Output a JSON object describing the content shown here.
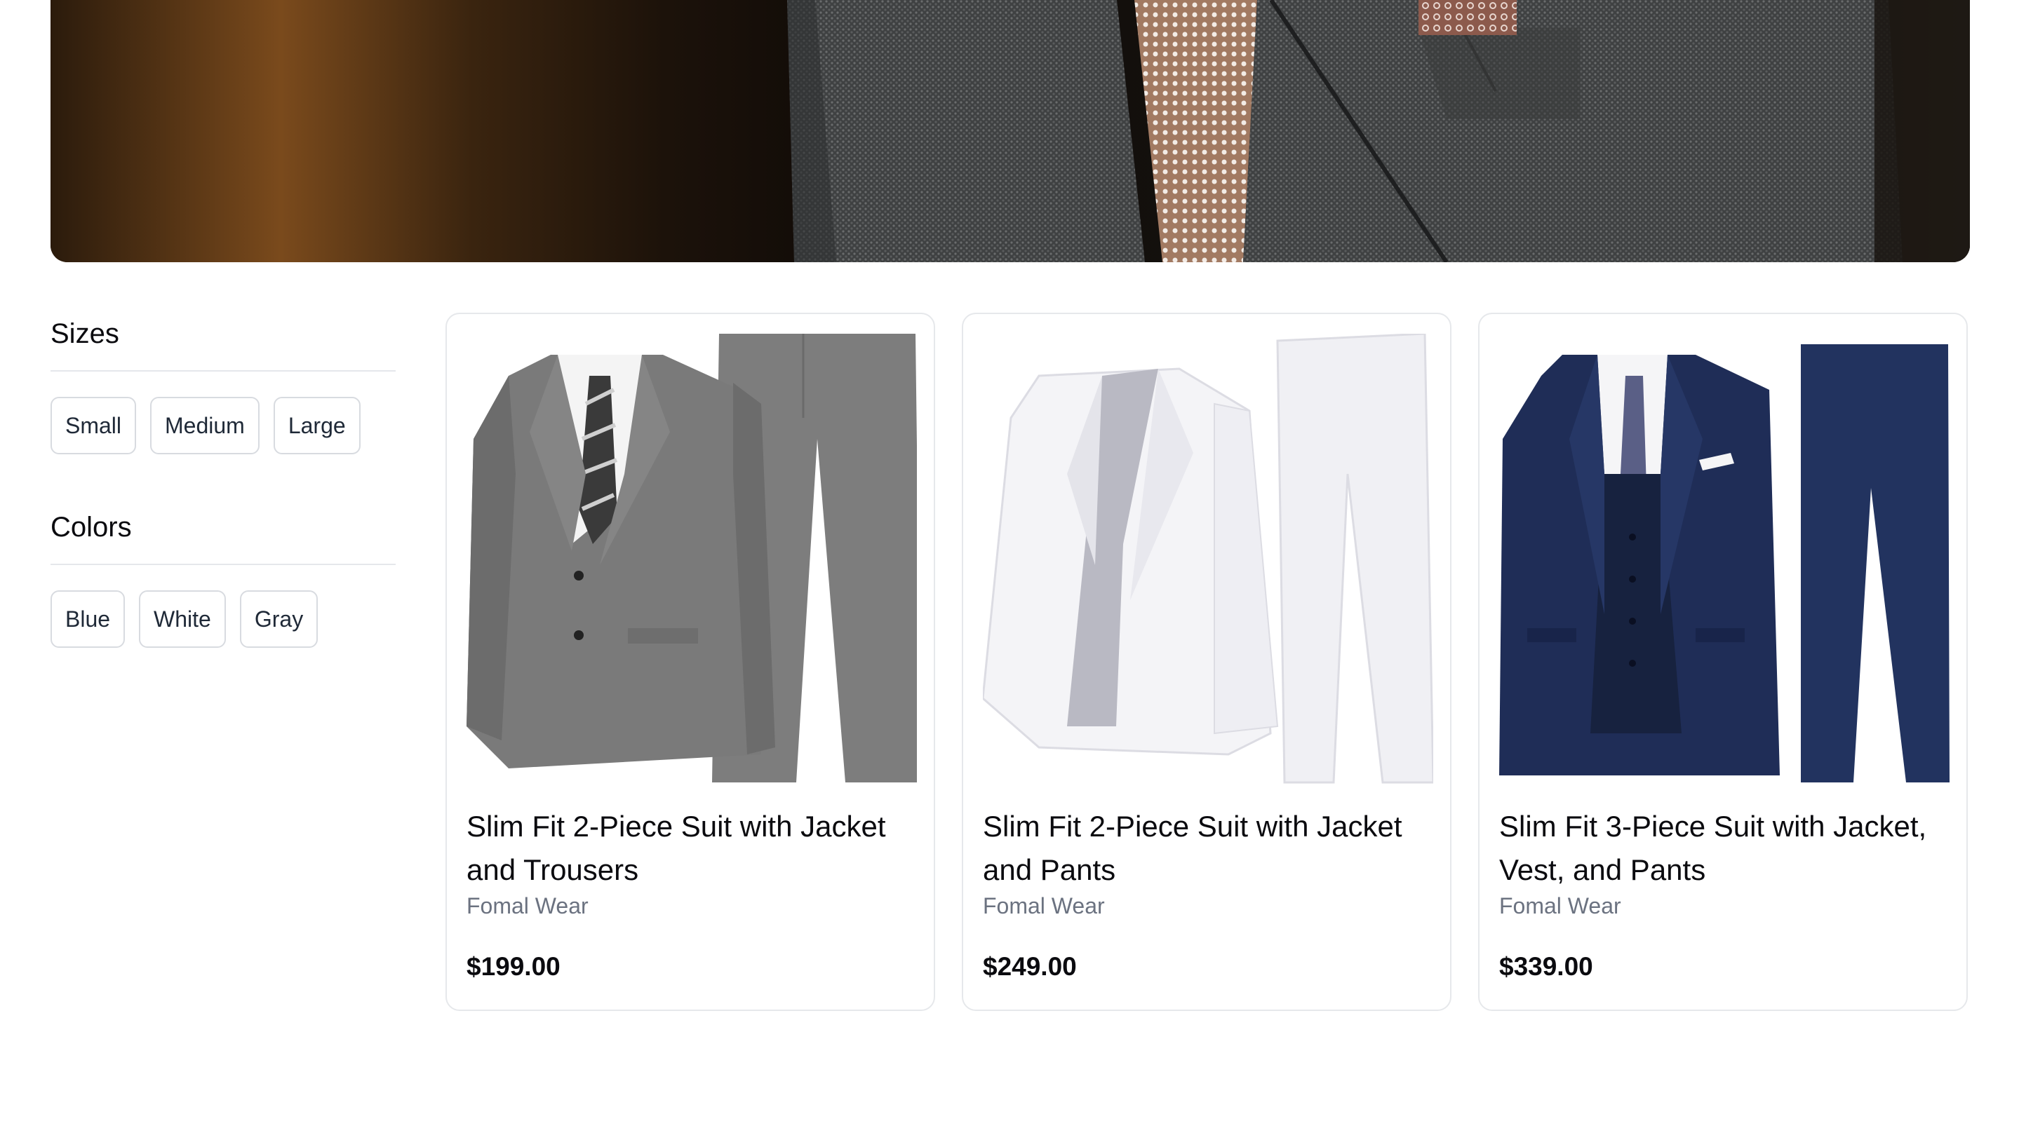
{
  "hero": {
    "image_alt": "Close-up of a gray suit jacket with a patterned tie and pocket square"
  },
  "filters": {
    "sizes": {
      "heading": "Sizes",
      "options": [
        "Small",
        "Medium",
        "Large"
      ]
    },
    "colors": {
      "heading": "Colors",
      "options": [
        "Blue",
        "White",
        "Gray"
      ]
    }
  },
  "products": [
    {
      "title": "Slim Fit 2-Piece Suit with Jacket and Trousers",
      "category": "Fomal Wear",
      "price": "$199.00",
      "image": "gray-suit"
    },
    {
      "title": "Slim Fit 2-Piece Suit with Jacket and Pants",
      "category": "Fomal Wear",
      "price": "$249.00",
      "image": "white-suit"
    },
    {
      "title": "Slim Fit 3-Piece Suit with Jacket, Vest, and Pants",
      "category": "Fomal Wear",
      "price": "$339.00",
      "image": "navy-suit"
    }
  ],
  "colors": {
    "gray_suit": "#6f6f6f",
    "white_suit": "#f3f3f6",
    "navy_suit": "#1e2d5c",
    "tie_brown": "#8a5a44"
  }
}
